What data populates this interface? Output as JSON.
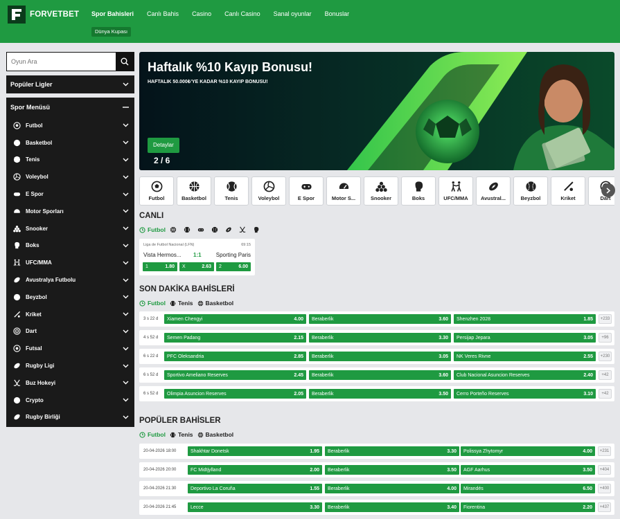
{
  "brand": {
    "name": "FORVETBET"
  },
  "nav": {
    "items": [
      {
        "label": "Spor Bahisleri",
        "active": true
      },
      {
        "label": "Canlı Bahis"
      },
      {
        "label": "Casino"
      },
      {
        "label": "Canlı Casino"
      },
      {
        "label": "Sanal oyunlar"
      },
      {
        "label": "Bonuslar"
      }
    ],
    "sub": "Dünya Kupası"
  },
  "search": {
    "placeholder": "Oyun Ara"
  },
  "sidebar": {
    "popular_title": "Popüler Ligler",
    "menu_title": "Spor Menüsü",
    "items": [
      {
        "label": "Futbol",
        "icon": "soccer-ball-icon"
      },
      {
        "label": "Basketbol",
        "icon": "basketball-icon"
      },
      {
        "label": "Tenis",
        "icon": "tennis-ball-icon"
      },
      {
        "label": "Voleybol",
        "icon": "volleyball-icon"
      },
      {
        "label": "E Spor",
        "icon": "gamepad-icon"
      },
      {
        "label": "Motor Sporları",
        "icon": "speedometer-icon"
      },
      {
        "label": "Snooker",
        "icon": "snooker-balls-icon"
      },
      {
        "label": "Boks",
        "icon": "boxing-glove-icon"
      },
      {
        "label": "UFC/MMA",
        "icon": "fighters-icon"
      },
      {
        "label": "Avustralya Futbolu",
        "icon": "rugby-ball-icon"
      },
      {
        "label": "Beyzbol",
        "icon": "baseball-icon"
      },
      {
        "label": "Kriket",
        "icon": "cricket-bat-icon"
      },
      {
        "label": "Dart",
        "icon": "dart-target-icon"
      },
      {
        "label": "Futsal",
        "icon": "futsal-ball-icon"
      },
      {
        "label": "Rugby Ligi",
        "icon": "rugby-ball-icon"
      },
      {
        "label": "Buz Hokeyi",
        "icon": "hockey-sticks-icon"
      },
      {
        "label": "Crypto",
        "icon": "bitcoin-icon"
      },
      {
        "label": "Rugby Birliği",
        "icon": "rugby-ball-icon"
      }
    ]
  },
  "banner": {
    "title": "Haftalık %10 Kayıp Bonusu!",
    "subtitle": "HAFTALIK 50.000₺'YE KADAR %10 KAYIP BONUSU!",
    "button": "Detaylar",
    "pager": "2 / 6"
  },
  "sports_bar": [
    {
      "label": "Futbol",
      "icon": "soccer-ball-icon"
    },
    {
      "label": "Basketbol",
      "icon": "basketball-icon"
    },
    {
      "label": "Tenis",
      "icon": "tennis-ball-icon"
    },
    {
      "label": "Voleybol",
      "icon": "volleyball-icon"
    },
    {
      "label": "E Spor",
      "icon": "gamepad-icon"
    },
    {
      "label": "Motor S...",
      "icon": "speedometer-icon"
    },
    {
      "label": "Snooker",
      "icon": "snooker-balls-icon"
    },
    {
      "label": "Boks",
      "icon": "boxing-glove-icon"
    },
    {
      "label": "UFC/MMA",
      "icon": "fighters-icon"
    },
    {
      "label": "Avustral...",
      "icon": "rugby-ball-icon"
    },
    {
      "label": "Beyzbol",
      "icon": "baseball-icon"
    },
    {
      "label": "Kriket",
      "icon": "cricket-bat-icon"
    },
    {
      "label": "Dart",
      "icon": "dart-target-icon"
    }
  ],
  "live": {
    "title": "CANLI",
    "filter_active": "Futbol",
    "filter_icons": [
      "basketball-icon",
      "tennis-ball-icon",
      "gamepad-icon",
      "baseball-icon",
      "rugby-ball-icon",
      "hockey-sticks-icon",
      "boxing-glove-icon"
    ],
    "match": {
      "league": "Liga de Futbol Nacional (LFN)",
      "minute": "69:15",
      "home": "Vista Hermos...",
      "score": "1:1",
      "away": "Sporting Paris",
      "odds": [
        {
          "label": "1",
          "value": "1.80"
        },
        {
          "label": "X",
          "value": "2.63"
        },
        {
          "label": "2",
          "value": "6.00"
        }
      ]
    }
  },
  "last_minute": {
    "title": "SON DAKİKA BAHİSLERİ",
    "filters": [
      "Futbol",
      "Tenis",
      "Basketbol"
    ],
    "rows": [
      {
        "time": "3 s 22 d",
        "home": "Xiamen Chengyi",
        "home_odd": "4.00",
        "draw": "Beraberlik",
        "draw_odd": "3.60",
        "away": "Shenzhen 2028",
        "away_odd": "1.85",
        "more": "+233"
      },
      {
        "time": "4 s 52 d",
        "home": "Semen Padang",
        "home_odd": "2.15",
        "draw": "Beraberlik",
        "draw_odd": "3.30",
        "away": "Persijap Jepara",
        "away_odd": "3.05",
        "more": "+96"
      },
      {
        "time": "6 s 22 d",
        "home": "PFC Oleksandria",
        "home_odd": "2.85",
        "draw": "Beraberlik",
        "draw_odd": "3.05",
        "away": "NK Veres Rivne",
        "away_odd": "2.55",
        "more": "+230"
      },
      {
        "time": "6 s 52 d",
        "home": "Sportivo Ameliano Reserves",
        "home_odd": "2.45",
        "draw": "Beraberlik",
        "draw_odd": "3.60",
        "away": "Club Nacional Asuncion Reserves",
        "away_odd": "2.40",
        "more": "+42"
      },
      {
        "time": "6 s 52 d",
        "home": "Olimpia Asuncion Reserves",
        "home_odd": "2.05",
        "draw": "Beraberlik",
        "draw_odd": "3.50",
        "away": "Cerro Porteño Reserves",
        "away_odd": "3.10",
        "more": "+42"
      }
    ]
  },
  "popular": {
    "title": "POPÜLER BAHİSLER",
    "filters": [
      "Futbol",
      "Tenis",
      "Basketbol"
    ],
    "rows": [
      {
        "time": "20-04-2026 18:00",
        "home": "Shakhtar Donetsk",
        "home_odd": "1.95",
        "draw": "Beraberlik",
        "draw_odd": "3.30",
        "away": "Polissya Zhytomyr",
        "away_odd": "4.00",
        "more": "+231"
      },
      {
        "time": "20-04-2026 20:00",
        "home": "FC Midtjylland",
        "home_odd": "2.00",
        "draw": "Beraberlik",
        "draw_odd": "3.50",
        "away": "AGF Aarhus",
        "away_odd": "3.50",
        "more": "+404"
      },
      {
        "time": "20-04-2026 21:30",
        "home": "Deportivo La Coruña",
        "home_odd": "1.55",
        "draw": "Beraberlik",
        "draw_odd": "4.00",
        "away": "Mirandés",
        "away_odd": "6.50",
        "more": "+400"
      },
      {
        "time": "20-04-2026 21:45",
        "home": "Lecce",
        "home_odd": "3.30",
        "draw": "Beraberlik",
        "draw_odd": "3.40",
        "away": "Fiorentina",
        "away_odd": "2.20",
        "more": "+437"
      }
    ]
  },
  "colors": {
    "brand_green": "#1f9a41",
    "dark_green": "#0b3b1b",
    "sidebar_bg": "#1a1a1a",
    "page_bg": "#e6e7ea"
  }
}
